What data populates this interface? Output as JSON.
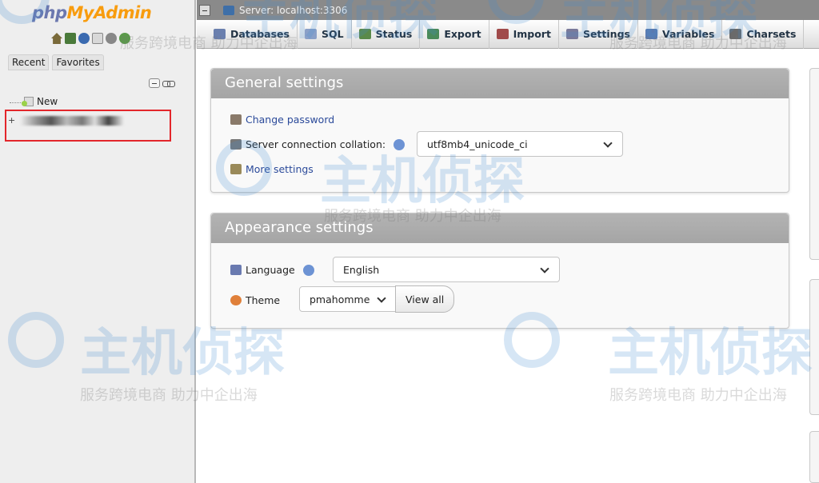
{
  "logo": {
    "php": "php",
    "myadmin": "MyAdmin"
  },
  "sidebar": {
    "tabs": [
      "Recent",
      "Favorites"
    ],
    "tree_new": "New"
  },
  "topbar": {
    "server": "Server: localhost:3306"
  },
  "menu": [
    {
      "label": "Databases",
      "icon": "database-icon",
      "color": "#6a7fae"
    },
    {
      "label": "SQL",
      "icon": "sql-icon",
      "color": "#8aa0c8"
    },
    {
      "label": "Status",
      "icon": "status-icon",
      "color": "#5a8a4a"
    },
    {
      "label": "Export",
      "icon": "export-icon",
      "color": "#4a8a5a"
    },
    {
      "label": "Import",
      "icon": "import-icon",
      "color": "#a04a4a"
    },
    {
      "label": "Settings",
      "icon": "settings-icon",
      "color": "#7a7a9a"
    },
    {
      "label": "Variables",
      "icon": "variables-icon",
      "color": "#5a7ab0"
    },
    {
      "label": "Charsets",
      "icon": "charsets-icon",
      "color": "#6a6a6a"
    }
  ],
  "general": {
    "title": "General settings",
    "change_password": "Change password",
    "collation_label": "Server connection collation:",
    "collation_value": "utf8mb4_unicode_ci",
    "more_settings": "More settings"
  },
  "appearance": {
    "title": "Appearance settings",
    "language_label": "Language",
    "language_value": "English",
    "theme_label": "Theme",
    "theme_value": "pmahomme",
    "view_all": "View all"
  },
  "watermark": {
    "big": "主机侦探",
    "small": "服务跨境电商 助力中企出海"
  }
}
